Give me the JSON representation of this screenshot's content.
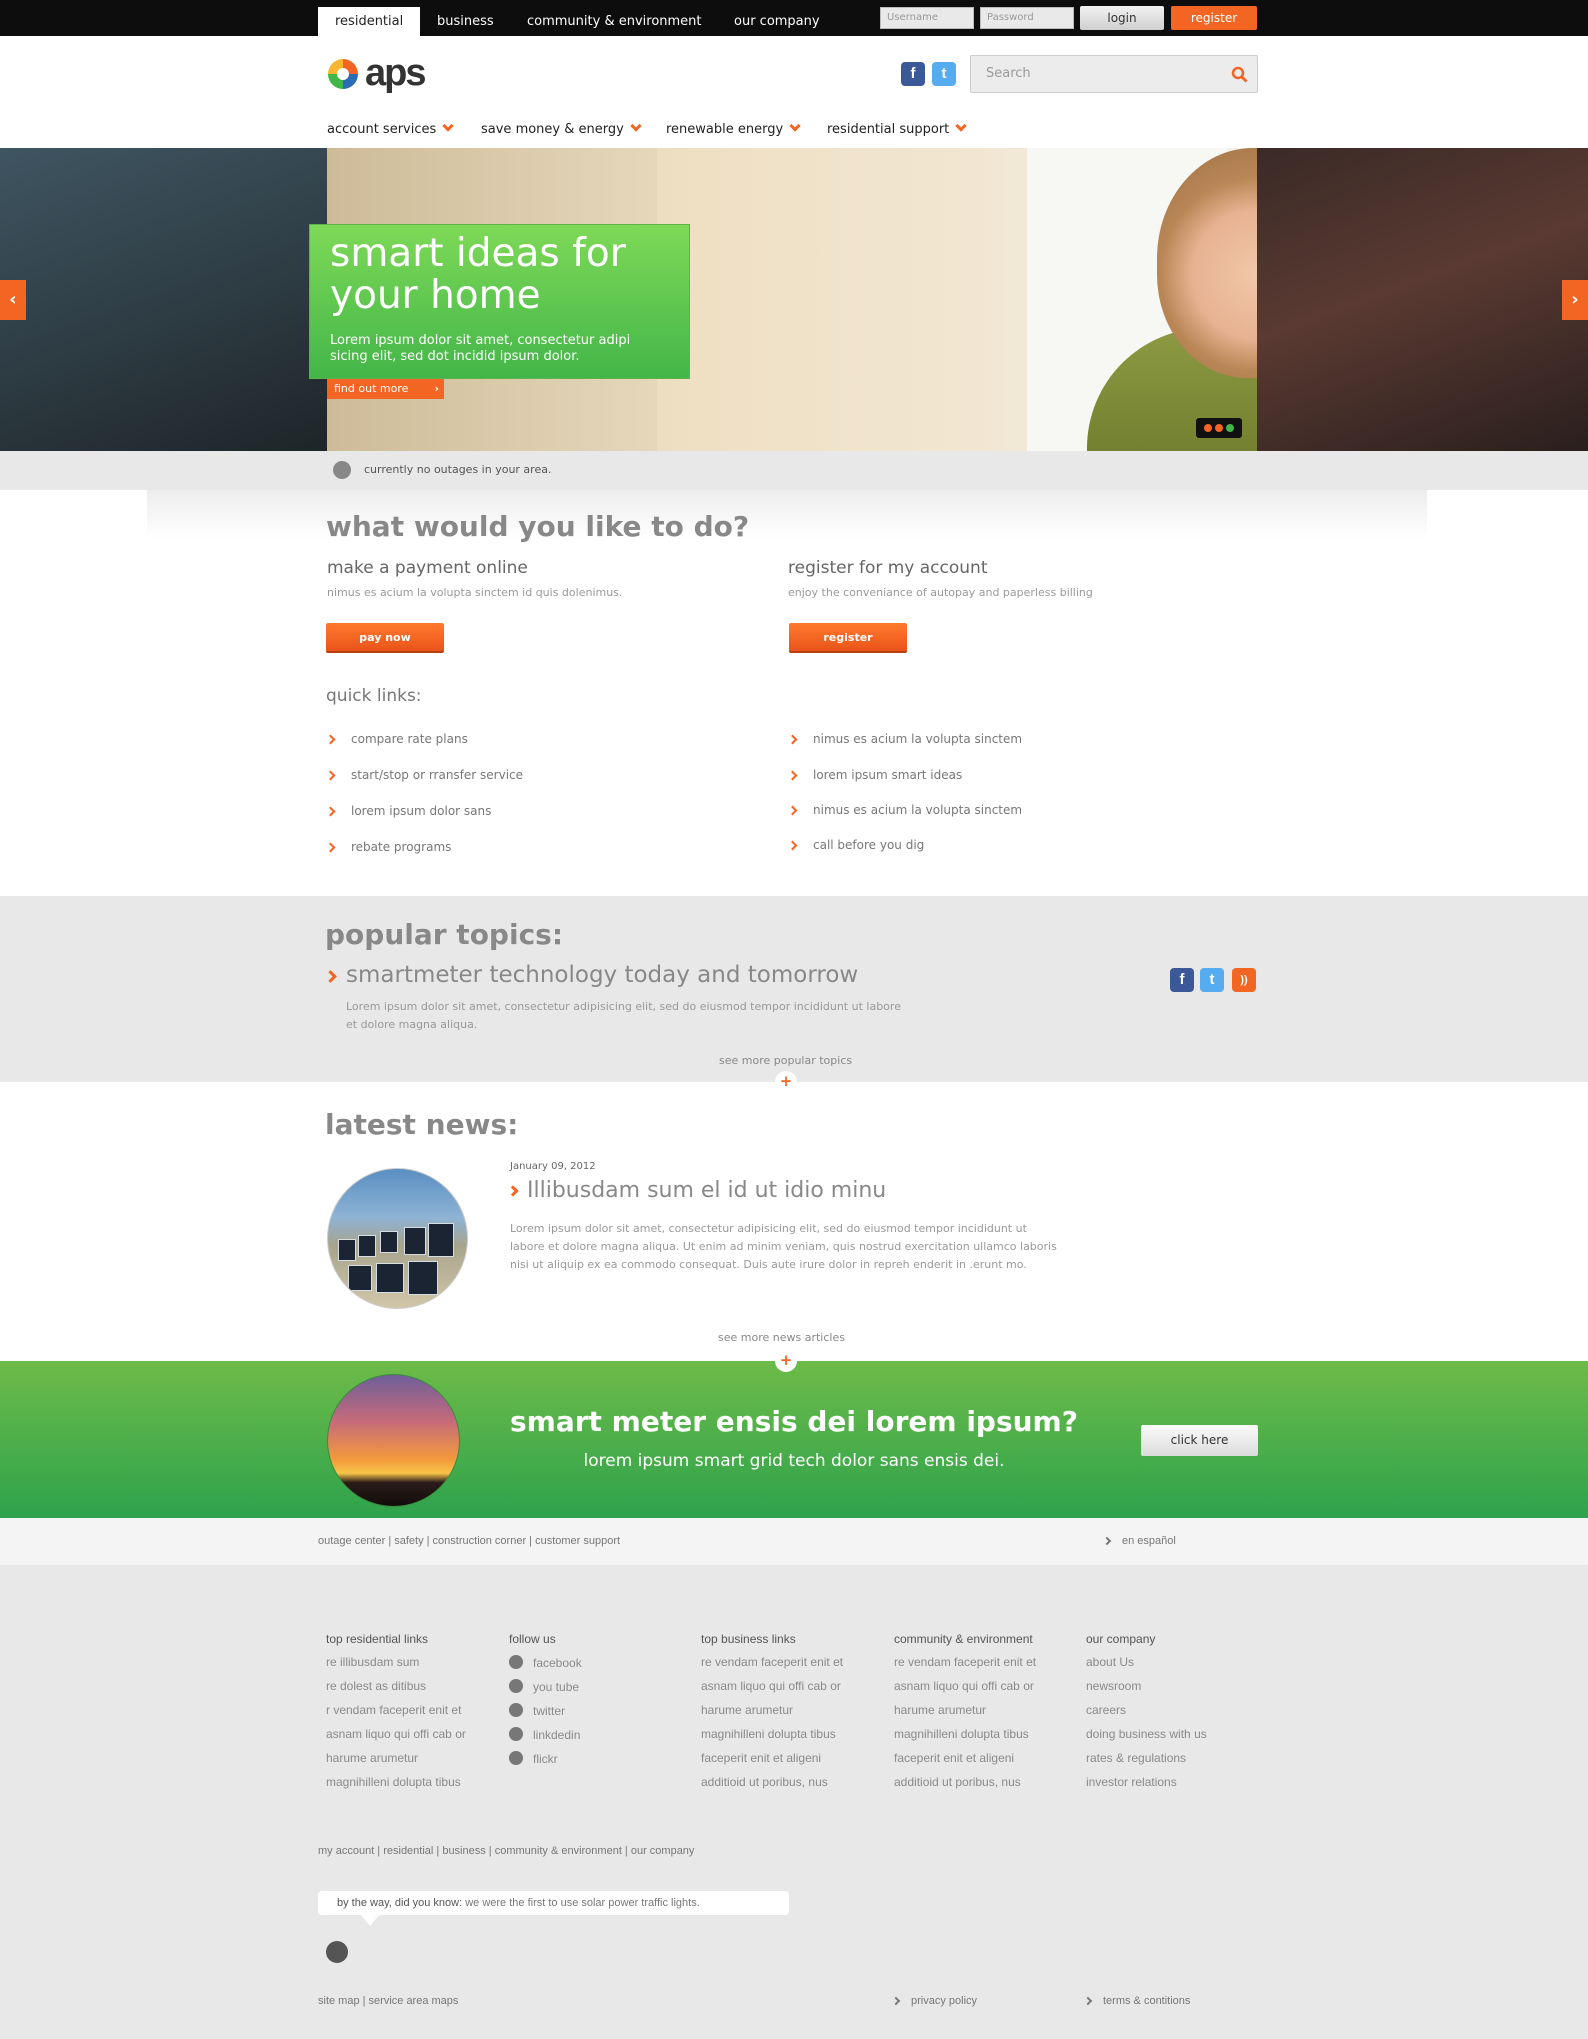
{
  "top_tabs": [
    "residential",
    "business",
    "community & environment",
    "our company"
  ],
  "login": {
    "username_placeholder": "Username",
    "password_placeholder": "Password",
    "login_label": "login",
    "register_label": "register"
  },
  "logo_text": "aps",
  "search": {
    "placeholder": "Search"
  },
  "nav": [
    "account services",
    "save money & energy",
    "renewable energy",
    "residential support"
  ],
  "hero": {
    "title": "smart ideas for your home",
    "body": "Lorem ipsum dolor sit amet, consectetur adipi sicing elit, sed dot incidid  ipsum dolor.",
    "cta": "find out more"
  },
  "outage_text": "currently no outages in your area.",
  "what": {
    "title": "what would you like to do?",
    "payment": {
      "title": "make a payment online",
      "desc": "nimus es acium la volupta sinctem id quis dolenimus.",
      "button": "pay now"
    },
    "register": {
      "title": "register for my account",
      "desc": "enjoy the conveniance of autopay and paperless billing",
      "button": "register"
    }
  },
  "quick_links": {
    "title": "quick links:",
    "left": [
      "compare rate plans",
      "start/stop or rransfer service",
      "lorem ipsum dolor sans",
      "rebate programs"
    ],
    "right": [
      "nimus es acium la volupta sinctem",
      "lorem ipsum smart ideas",
      "nimus es acium la volupta sinctem",
      "call before you dig"
    ]
  },
  "popular": {
    "title": "popular topics:",
    "topic": "smartmeter technology today and tomorrow",
    "body": "Lorem ipsum dolor sit amet, consectetur adipisicing elit, sed do eiusmod tempor incididunt ut labore et dolore magna aliqua.",
    "more": "see more popular topics"
  },
  "news": {
    "title": "latest news:",
    "date": "January 09, 2012",
    "headline": "Illibusdam sum el id ut idio minu",
    "body": "Lorem ipsum dolor sit amet, consectetur adipisicing elit, sed do eiusmod tempor incididunt ut labore et dolore magna aliqua. Ut enim ad minim veniam, quis nostrud exercitation ullamco laboris nisi ut aliquip ex ea commodo consequat. Duis aute irure dolor in repreh enderit in .erunt mo.",
    "more": "see more news articles"
  },
  "promo_band": {
    "title": "smart meter ensis dei lorem ipsum?",
    "subtitle": "lorem ipsum smart grid tech dolor sans ensis dei.",
    "button": "click here"
  },
  "utility": {
    "links": "outage center | safety | construction corner | customer support",
    "espanol": "en español"
  },
  "footer": {
    "columns": [
      {
        "heading": "top residential links",
        "items": [
          "re illibusdam sum",
          "re dolest as ditibus",
          "r vendam faceperit enit et",
          "asnam liquo qui offi cab or",
          "harume arumetur",
          "magnihilleni dolupta tibus"
        ]
      },
      {
        "heading": "follow us",
        "items": [
          "facebook",
          "you tube",
          "twitter",
          "linkdedin",
          "flickr"
        ]
      },
      {
        "heading": "top business links",
        "items": [
          "re vendam faceperit enit et",
          "asnam liquo qui offi cab or",
          "harume arumetur",
          "magnihilleni dolupta tibus",
          "faceperit enit et aligeni",
          "additioid ut poribus, nus"
        ]
      },
      {
        "heading": "community & environment",
        "items": [
          "re vendam faceperit enit et",
          "asnam liquo qui offi cab or",
          "harume arumetur",
          "magnihilleni dolupta tibus",
          "faceperit enit et aligeni",
          "additioid ut poribus, nus"
        ]
      },
      {
        "heading": "our company",
        "items": [
          "about Us",
          "newsroom",
          "careers",
          "doing business with us",
          "rates & regulations",
          "investor relations"
        ]
      }
    ],
    "nav_links": "my account | residential | business | community & environment | our company",
    "fact_prefix": "by the way, did you know:",
    "fact_text": " we were the first to use solar power traffic lights.",
    "bottom_links": "site map | service area maps",
    "privacy": "privacy policy",
    "terms": "terms & contitions"
  },
  "colors": {
    "accent": "#f26522",
    "green": "#43b649",
    "dark": "#0d0d0d"
  },
  "icons": [
    "facebook-icon",
    "twitter-icon",
    "rss-icon",
    "search-icon",
    "chevron-down-icon",
    "chevron-right-icon",
    "plus-icon"
  ]
}
